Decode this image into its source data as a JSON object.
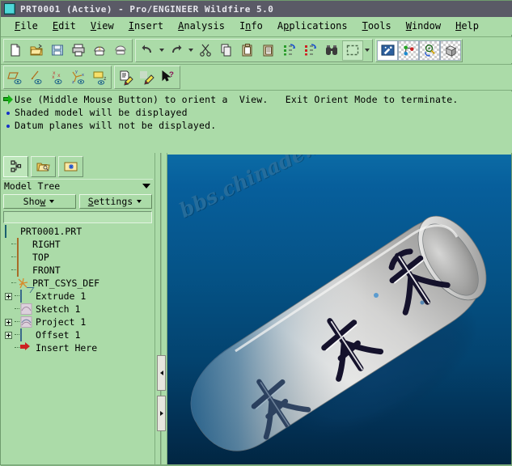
{
  "window": {
    "title": "PRT0001 (Active) - Pro/ENGINEER Wildfire 5.0",
    "icon": "window-icon",
    "title_bg": "#5a5a66",
    "app_bg": "#abdba8"
  },
  "menubar": {
    "items": [
      {
        "label": "File",
        "mnemonic": "F"
      },
      {
        "label": "Edit",
        "mnemonic": "E"
      },
      {
        "label": "View",
        "mnemonic": "V"
      },
      {
        "label": "Insert",
        "mnemonic": "I"
      },
      {
        "label": "Analysis",
        "mnemonic": "A"
      },
      {
        "label": "Info",
        "mnemonic": "n"
      },
      {
        "label": "Applications",
        "mnemonic": "p"
      },
      {
        "label": "Tools",
        "mnemonic": "T"
      },
      {
        "label": "Window",
        "mnemonic": "W"
      },
      {
        "label": "Help",
        "mnemonic": "H"
      }
    ]
  },
  "toolbar_row1": {
    "groups": [
      {
        "buttons": [
          {
            "icon": "new-file-icon",
            "label": "New"
          },
          {
            "icon": "open-folder-icon",
            "label": "Open"
          },
          {
            "icon": "save-icon",
            "label": "Save"
          },
          {
            "icon": "print-icon",
            "label": "Print"
          },
          {
            "icon": "print-preview-icon",
            "label": "Print Preview"
          },
          {
            "icon": "mail-icon",
            "label": "Send Mail"
          }
        ]
      },
      {
        "buttons": [
          {
            "icon": "undo-icon",
            "label": "Undo",
            "has_dropdown": true
          },
          {
            "icon": "redo-icon",
            "label": "Redo",
            "has_dropdown": true
          },
          {
            "icon": "cut-icon",
            "label": "Cut"
          },
          {
            "icon": "copy-icon",
            "label": "Copy"
          },
          {
            "icon": "paste-icon",
            "label": "Paste"
          },
          {
            "icon": "paste-special-icon",
            "label": "Paste Special"
          },
          {
            "icon": "regenerate-icon",
            "label": "Regenerate"
          },
          {
            "icon": "regenerate-all-icon",
            "label": "Regenerate All"
          },
          {
            "icon": "find-icon",
            "label": "Find"
          },
          {
            "icon": "select-box-icon",
            "label": "Select",
            "has_dropdown": true
          }
        ]
      },
      {
        "buttons": [
          {
            "icon": "repaint-icon",
            "label": "Repaint"
          },
          {
            "icon": "datum-points-icon",
            "label": "Datum Points Display"
          },
          {
            "icon": "spin-center-icon",
            "label": "Spin Center"
          },
          {
            "icon": "view-manager-icon",
            "label": "View Manager"
          }
        ]
      }
    ]
  },
  "toolbar_row2": {
    "groups": [
      {
        "buttons": [
          {
            "icon": "datum-plane-display-icon",
            "label": "Datum Plane Display"
          },
          {
            "icon": "datum-axis-display-icon",
            "label": "Datum Axis Display"
          },
          {
            "icon": "datum-point-display-icon",
            "label": "Datum Point Display"
          },
          {
            "icon": "datum-csys-display-icon",
            "label": "Coordinate System Display"
          },
          {
            "icon": "annotation-display-icon",
            "label": "Annotation Display"
          }
        ]
      },
      {
        "buttons": [
          {
            "icon": "sketch-edit-icon",
            "label": "Edit Definition"
          },
          {
            "icon": "paint-edit-icon",
            "label": "Edit Appearance"
          },
          {
            "icon": "context-help-icon",
            "label": "Context Sensitive Help"
          }
        ]
      }
    ]
  },
  "messages": {
    "lines": [
      {
        "bullet": "arrow",
        "text": "Use (Middle Mouse Button) to orient a  View.   Exit Orient Mode to terminate."
      },
      {
        "bullet": "dot",
        "text": "Shaded model will be displayed"
      },
      {
        "bullet": "dot",
        "text": "Datum planes will not be displayed."
      }
    ]
  },
  "navigator": {
    "tabs": [
      {
        "name": "model-tree-tab",
        "icon": "model-tree-icon",
        "active": true
      },
      {
        "name": "folder-browser-tab",
        "icon": "folder-icon",
        "active": false
      },
      {
        "name": "favorites-tab",
        "icon": "favorites-icon",
        "active": false
      }
    ],
    "panel_title": "Model Tree",
    "buttons": [
      {
        "label": "Show",
        "mnemonic": "w",
        "name": "show-button"
      },
      {
        "label": "Settings",
        "mnemonic": "S",
        "name": "settings-button"
      }
    ],
    "tree": [
      {
        "label": "PRT0001.PRT",
        "icon": "part-icon",
        "indent": 0,
        "expander": "none"
      },
      {
        "label": "RIGHT",
        "icon": "datum-plane-icon",
        "indent": 1,
        "expander": "none"
      },
      {
        "label": "TOP",
        "icon": "datum-plane-icon",
        "indent": 1,
        "expander": "none"
      },
      {
        "label": "FRONT",
        "icon": "datum-plane-icon",
        "indent": 1,
        "expander": "none"
      },
      {
        "label": "PRT_CSYS_DEF",
        "icon": "csys-icon",
        "indent": 1,
        "expander": "none"
      },
      {
        "label": "Extrude 1",
        "icon": "extrude-icon",
        "indent": 1,
        "expander": "plus"
      },
      {
        "label": "Sketch 1",
        "icon": "sketch-icon",
        "indent": 1,
        "expander": "none"
      },
      {
        "label": "Project 1",
        "icon": "project-icon",
        "indent": 1,
        "expander": "plus"
      },
      {
        "label": "Offset 1",
        "icon": "offset-icon",
        "indent": 1,
        "expander": "plus"
      },
      {
        "label": "Insert Here",
        "icon": "insert-here-icon",
        "indent": 1,
        "expander": "none"
      }
    ]
  },
  "splitter": {
    "collapse_left": "collapse-left-arrow",
    "collapse_right": "expand-right-arrow"
  },
  "viewport": {
    "watermark": "bbs.chinade.net",
    "bg_top": "#0b6ba5",
    "bg_bottom": "#012642",
    "model": {
      "name": "tapered-cylinder-part",
      "description": "Shaded tapered cylindrical solid with engraved Chinese calligraphy",
      "body_light": "#e9e9e9",
      "body_mid": "#c9c9c9",
      "body_dark": "#9b9b9b",
      "engraving": "#12102a",
      "shadow": "#06365d"
    }
  }
}
